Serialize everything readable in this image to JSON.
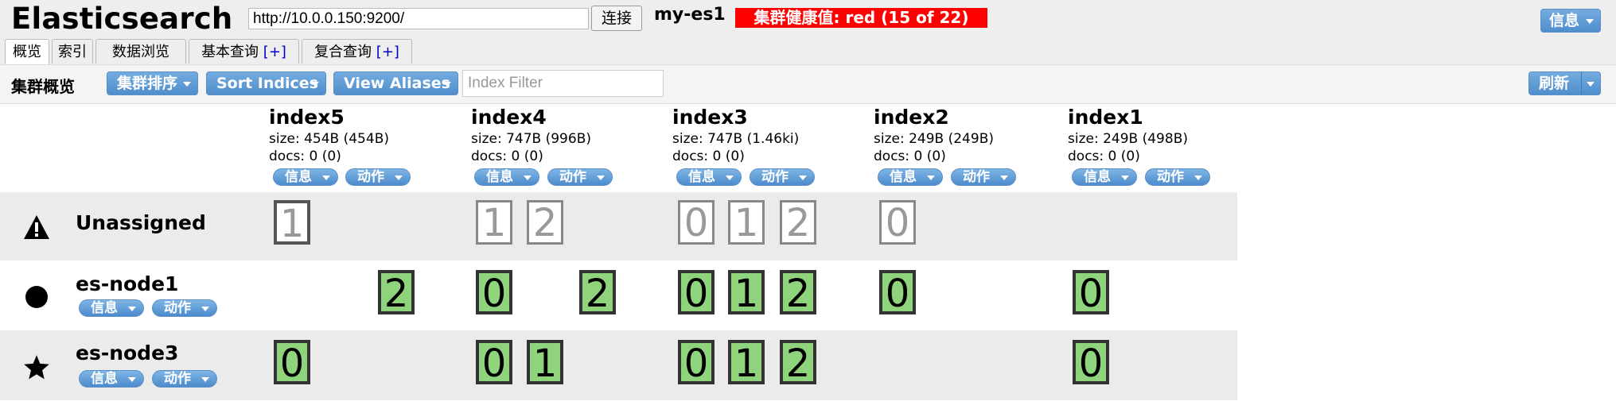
{
  "header": {
    "app_title": "Elasticsearch",
    "url": "http://10.0.0.150:9200/",
    "connect_label": "连接",
    "cluster_name": "my-es1",
    "health": "集群健康值: red (15 of 22)",
    "info_label": "信息"
  },
  "tabs": [
    {
      "label": "概览",
      "plus": ""
    },
    {
      "label": "索引",
      "plus": ""
    },
    {
      "label": "数据浏览",
      "plus": ""
    },
    {
      "label": "基本查询",
      "plus": "[+]"
    },
    {
      "label": "复合查询",
      "plus": "[+]"
    }
  ],
  "toolbar": {
    "title": "集群概览",
    "sort_cluster": "集群排序",
    "sort_indices": "Sort Indices",
    "view_aliases": "View Aliases",
    "filter_placeholder": "Index Filter",
    "refresh": "刷新"
  },
  "buttons": {
    "info": "信息",
    "action": "动作"
  },
  "indices": [
    {
      "name": "index5",
      "size": "size: 454B (454B)",
      "docs": "docs: 0 (0)"
    },
    {
      "name": "index4",
      "size": "size: 747B (996B)",
      "docs": "docs: 0 (0)"
    },
    {
      "name": "index3",
      "size": "size: 747B (1.46ki)",
      "docs": "docs: 0 (0)"
    },
    {
      "name": "index2",
      "size": "size: 249B (249B)",
      "docs": "docs: 0 (0)"
    },
    {
      "name": "index1",
      "size": "size: 249B (498B)",
      "docs": "docs: 0 (0)"
    }
  ],
  "rows": [
    {
      "name": "Unassigned",
      "icon": "warning-icon",
      "shards": [
        "1",
        "1",
        "2",
        "0",
        "1",
        "2",
        "0"
      ]
    },
    {
      "name": "es-node1",
      "icon": "circle-icon",
      "shards": [
        "2",
        "0",
        "2",
        "0",
        "1",
        "2",
        "0",
        "0"
      ]
    },
    {
      "name": "es-node3",
      "icon": "star-icon",
      "shards": [
        "0",
        "0",
        "1",
        "0",
        "1",
        "2",
        "0"
      ]
    }
  ]
}
